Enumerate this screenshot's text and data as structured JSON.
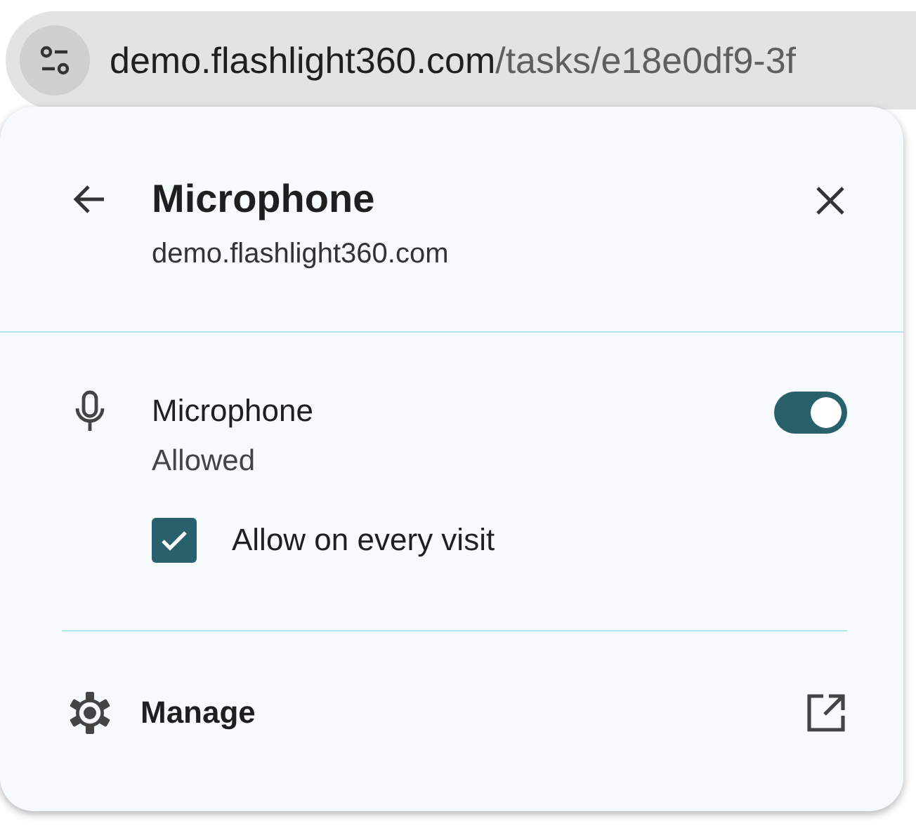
{
  "address_bar": {
    "host": "demo.flashlight360.com",
    "path": "/tasks/e18e0df9-3f"
  },
  "popup": {
    "title": "Microphone",
    "subtitle": "demo.flashlight360.com",
    "permission": {
      "name": "Microphone",
      "status": "Allowed",
      "on": true
    },
    "remember": {
      "label": "Allow on every visit",
      "checked": true
    },
    "footer": {
      "label": "Manage"
    }
  }
}
